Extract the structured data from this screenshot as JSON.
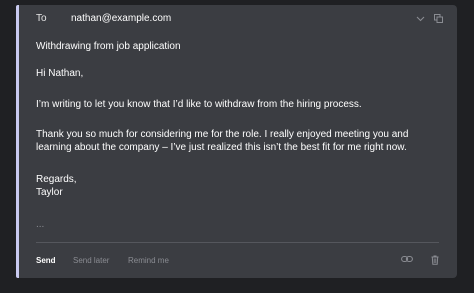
{
  "to": {
    "label": "To",
    "value": "nathan@example.com"
  },
  "subject": "Withdrawing from job application",
  "body": {
    "greeting": "Hi Nathan,",
    "p1": "I’m writing to let you know that I’d like to withdraw from the hiring process.",
    "p2": "Thank you so much for considering me for the role. I really enjoyed meeting you and learning about the company – I’ve just realized this isn’t the best fit for me right now.",
    "signoff": "Regards,",
    "name": "Taylor",
    "ellipsis": "..."
  },
  "footer": {
    "send": "Send",
    "send_later": "Send later",
    "remind_me": "Remind me"
  },
  "icons": {
    "header": [
      "chevron-down-icon",
      "copy-icon"
    ],
    "footer": [
      "link-icon",
      "trash-icon"
    ]
  },
  "colors": {
    "background": "#1f2023",
    "panel": "#3b3d42",
    "accent_bar": "#c9caf0",
    "muted": "#8a8c92"
  }
}
